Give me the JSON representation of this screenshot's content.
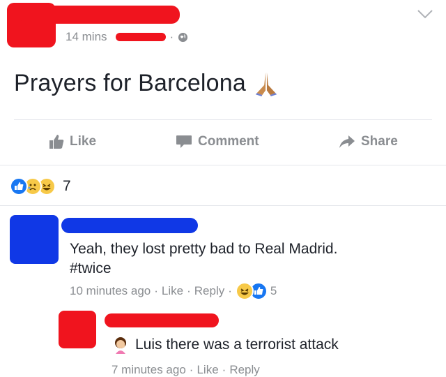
{
  "post": {
    "time": "14 mins",
    "separator": "·",
    "text": "Prayers for Barcelona",
    "emoji_icon": "praying-hands-icon"
  },
  "actions": {
    "like": "Like",
    "comment": "Comment",
    "share": "Share"
  },
  "reactions": {
    "count": "7",
    "icons": [
      "like-icon",
      "sad-icon",
      "haha-icon"
    ]
  },
  "comments": [
    {
      "text_line1": "Yeah, they lost pretty bad to Real Madrid.",
      "text_line2": "#twice",
      "time": "10 minutes ago",
      "sep": "·",
      "like": "Like",
      "reply": "Reply",
      "reaction_count": "5"
    },
    {
      "text": "Luis there was a terrorist attack",
      "time": "7 minutes ago",
      "sep": "·",
      "like": "Like",
      "reply": "Reply"
    }
  ],
  "colors": {
    "redaction_red": "#f0141e",
    "redaction_blue": "#1038e6",
    "like_blue": "#1877f2",
    "meta_gray": "#8a8d91"
  }
}
